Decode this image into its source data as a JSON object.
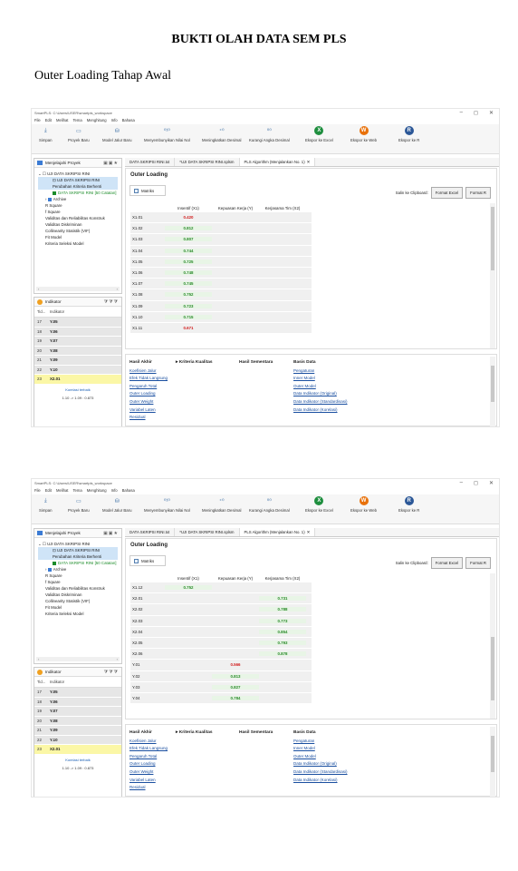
{
  "doc": {
    "title": "BUKTI OLAH DATA SEM PLS",
    "subtitle": "Outer Loading Tahap Awal"
  },
  "window": {
    "title": "SmartPLS: C:\\Users\\USER\\smartpls_workspace",
    "min": "–",
    "max": "◻",
    "close": "✕"
  },
  "menu": [
    "File",
    "Edit",
    "Melihat",
    "Tema",
    "Menghitung",
    "Info",
    "Bahasa"
  ],
  "ribbon": [
    {
      "label": "Simpan",
      "icon": "save-icon"
    },
    {
      "label": "Proyek Baru",
      "icon": "new-project-icon"
    },
    {
      "label": "Model Jalur Baru",
      "icon": "path-model-icon"
    },
    {
      "label": "Menyembunyikan Nilai Nol",
      "icon": "hide-zero-icon"
    },
    {
      "label": "Meningkatkan Desimal",
      "icon": "increase-decimal-icon"
    },
    {
      "label": "Kurangi Angka Desimal",
      "icon": "decrease-decimal-icon"
    },
    {
      "label": "Ekspor ke Excel",
      "icon": "excel-icon",
      "color": "#1e8e3e"
    },
    {
      "label": "Ekspor ke Web",
      "icon": "web-icon",
      "color": "#e8710a"
    },
    {
      "label": "Ekspor ke R",
      "icon": "r-icon",
      "color": "#2b5797"
    }
  ],
  "explorer": {
    "title": "Menjelajahi Proyek",
    "items": [
      "UJI DATA SKRIPSI RINI",
      "UJI DATA SKRIPSI RINI",
      "DATA SKRIPSI RINI [50 Catatan]",
      "Archive"
    ]
  },
  "indicators": {
    "title": "Indikator",
    "col1": "Tid...",
    "col2": "Indikator",
    "rows": [
      [
        "17",
        "Y.05"
      ],
      [
        "18",
        "Y.06"
      ],
      [
        "19",
        "Y.07"
      ],
      [
        "20",
        "Y.08"
      ],
      [
        "21",
        "Y.09"
      ],
      [
        "22",
        "Y.10"
      ],
      [
        "23",
        "X2.01"
      ]
    ],
    "link": "Korelasi terbaik",
    "range": "1.10 -> 1.09 : 0.873"
  },
  "tabs": [
    "DATA SKRIPSI RINI.txt",
    "*UJI DATA SKRIPSI RINI.splsm",
    "PLS Algorithm (Menjalankan No. 1)"
  ],
  "main": {
    "title": "Outer Loading",
    "matriks": "Matriks",
    "clip": "Salin ke Clipboard:",
    "btn_excel": "Format Excel",
    "btn_r": "Format R",
    "columns": [
      "Insentif (X1)",
      "Kepuasan Kerja (Y)",
      "Kerjasama Tim (X2)"
    ]
  },
  "rows1": [
    {
      "id": "X1.01",
      "c": 0,
      "v": "0.420",
      "color": "red"
    },
    {
      "id": "X1.02",
      "c": 0,
      "v": "0.812",
      "color": "green"
    },
    {
      "id": "X1.03",
      "c": 0,
      "v": "0.807",
      "color": "green"
    },
    {
      "id": "X1.04",
      "c": 0,
      "v": "0.744",
      "color": "green"
    },
    {
      "id": "X1.05",
      "c": 0,
      "v": "0.725",
      "color": "green"
    },
    {
      "id": "X1.06",
      "c": 0,
      "v": "0.748",
      "color": "green"
    },
    {
      "id": "X1.07",
      "c": 0,
      "v": "0.745",
      "color": "green"
    },
    {
      "id": "X1.08",
      "c": 0,
      "v": "0.752",
      "color": "green"
    },
    {
      "id": "X1.09",
      "c": 0,
      "v": "0.723",
      "color": "green"
    },
    {
      "id": "X1.10",
      "c": 0,
      "v": "0.715",
      "color": "green"
    },
    {
      "id": "X1.11",
      "c": 0,
      "v": "0.671",
      "color": "red"
    }
  ],
  "rows2": [
    {
      "id": "X1.12",
      "c": 0,
      "v": "0.752",
      "color": "green"
    },
    {
      "id": "X2.01",
      "c": 2,
      "v": "0.731",
      "color": "green"
    },
    {
      "id": "X2.02",
      "c": 2,
      "v": "0.788",
      "color": "green"
    },
    {
      "id": "X2.03",
      "c": 2,
      "v": "0.773",
      "color": "green"
    },
    {
      "id": "X2.04",
      "c": 2,
      "v": "0.854",
      "color": "green"
    },
    {
      "id": "X2.05",
      "c": 2,
      "v": "0.793",
      "color": "green"
    },
    {
      "id": "X2.06",
      "c": 2,
      "v": "0.878",
      "color": "green"
    },
    {
      "id": "Y.01",
      "c": 1,
      "v": "0.566",
      "color": "red"
    },
    {
      "id": "Y.02",
      "c": 1,
      "v": "0.813",
      "color": "green"
    },
    {
      "id": "Y.03",
      "c": 1,
      "v": "0.827",
      "color": "green"
    },
    {
      "id": "Y.04",
      "c": 1,
      "v": "0.784",
      "color": "green"
    }
  ],
  "bottom": {
    "h1": "Hasil Akhir",
    "l1": [
      "Koefisien Jalur",
      "Efek Tidak Langsung",
      "Pengaruh Total",
      "Outer Loading",
      "Outer Weight",
      "Variabel Laten",
      "Residual"
    ],
    "h2": "Kriteria Kualitas",
    "l2": [
      "R Square",
      "f Square",
      "Validitas dan Reliabilitas Konstruk",
      "Validitas Diskriminan",
      "Collinearity Statistik (VIF)",
      "Fit Model",
      "Kriteria Seleksi Model"
    ],
    "h3": "Hasil Sementara",
    "l3": [
      "Perubahan Kriteria Berhenti"
    ],
    "h4": "Basis Data",
    "l4": [
      "Pengaturan",
      "Inner Model",
      "Outer Model",
      "Data Indikator (Original)",
      "Data Indikator (Standardisasi)",
      "Data Indikator (Korelasi)"
    ]
  }
}
